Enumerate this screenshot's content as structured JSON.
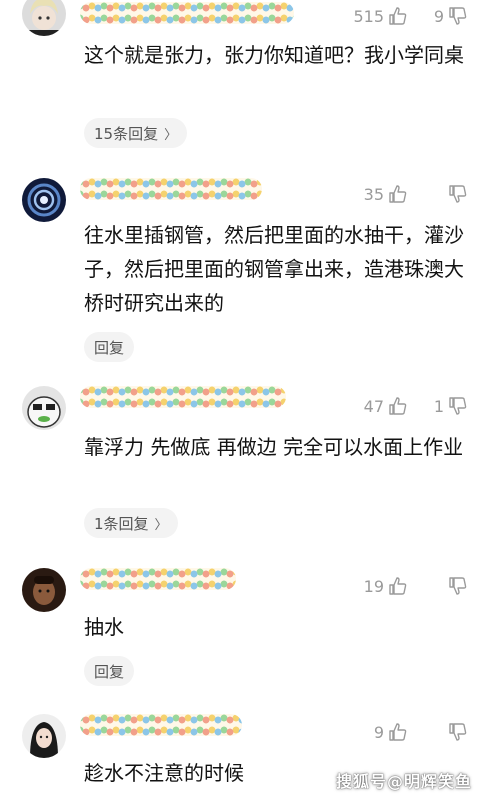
{
  "comments": [
    {
      "likes": "515",
      "dislikes": "9",
      "text": "这个就是张力，张力你知道吧？我小学同桌",
      "reply_label": "15条回复",
      "reply_chevron": "〉"
    },
    {
      "likes": "35",
      "dislikes": "",
      "text": "往水里插钢管，然后把里面的水抽干，灌沙子，然后把里面的钢管拿出来，造港珠澳大桥时研究出来的",
      "reply_label": "回复",
      "reply_chevron": ""
    },
    {
      "likes": "47",
      "dislikes": "1",
      "text": "靠浮力 先做底 再做边 完全可以水面上作业",
      "reply_label": "1条回复",
      "reply_chevron": "〉"
    },
    {
      "likes": "19",
      "dislikes": "",
      "text": "抽水",
      "reply_label": "回复",
      "reply_chevron": ""
    },
    {
      "likes": "9",
      "dislikes": "",
      "text": "趁水不注意的时候",
      "reply_label": "",
      "reply_chevron": ""
    }
  ],
  "watermark": "搜狐号@明辉笑鱼",
  "colors": {
    "icon_gray": "#9a9a9a",
    "pill_bg": "#f3f3f3"
  }
}
